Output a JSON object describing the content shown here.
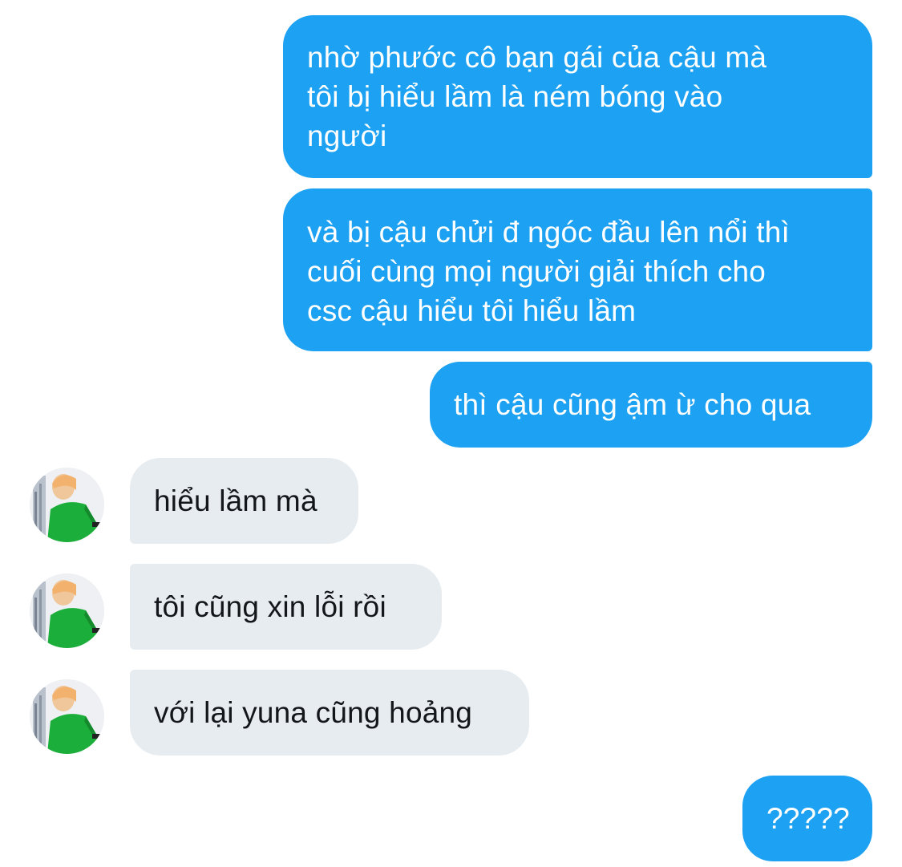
{
  "colors": {
    "sent_bubble": "#1da1f2",
    "received_bubble": "#e6ecf0",
    "sent_text": "#ffffff",
    "received_text": "#14171a",
    "background": "#ffffff"
  },
  "messages": [
    {
      "sender": "me",
      "lines": [
        "nhờ phước cô bạn gái của cậu mà",
        "tôi bị hiểu lầm là ném bóng vào",
        "người"
      ]
    },
    {
      "sender": "me",
      "lines": [
        "và bị cậu chửi đ ngóc đầu lên nổi thì",
        "cuối cùng mọi người giải thích cho",
        "csc cậu hiểu tôi hiểu lầm"
      ]
    },
    {
      "sender": "me",
      "lines": [
        "thì cậu cũng ậm ừ cho qua"
      ]
    },
    {
      "sender": "them",
      "lines": [
        "hiểu lầm mà"
      ],
      "avatar": "user-avatar-photo"
    },
    {
      "sender": "them",
      "lines": [
        "tôi cũng xin lỗi rồi"
      ],
      "avatar": "user-avatar-photo"
    },
    {
      "sender": "them",
      "lines": [
        "với lại yuna cũng hoảng"
      ],
      "avatar": "user-avatar-photo"
    },
    {
      "sender": "me",
      "lines": [
        "?????"
      ]
    }
  ]
}
